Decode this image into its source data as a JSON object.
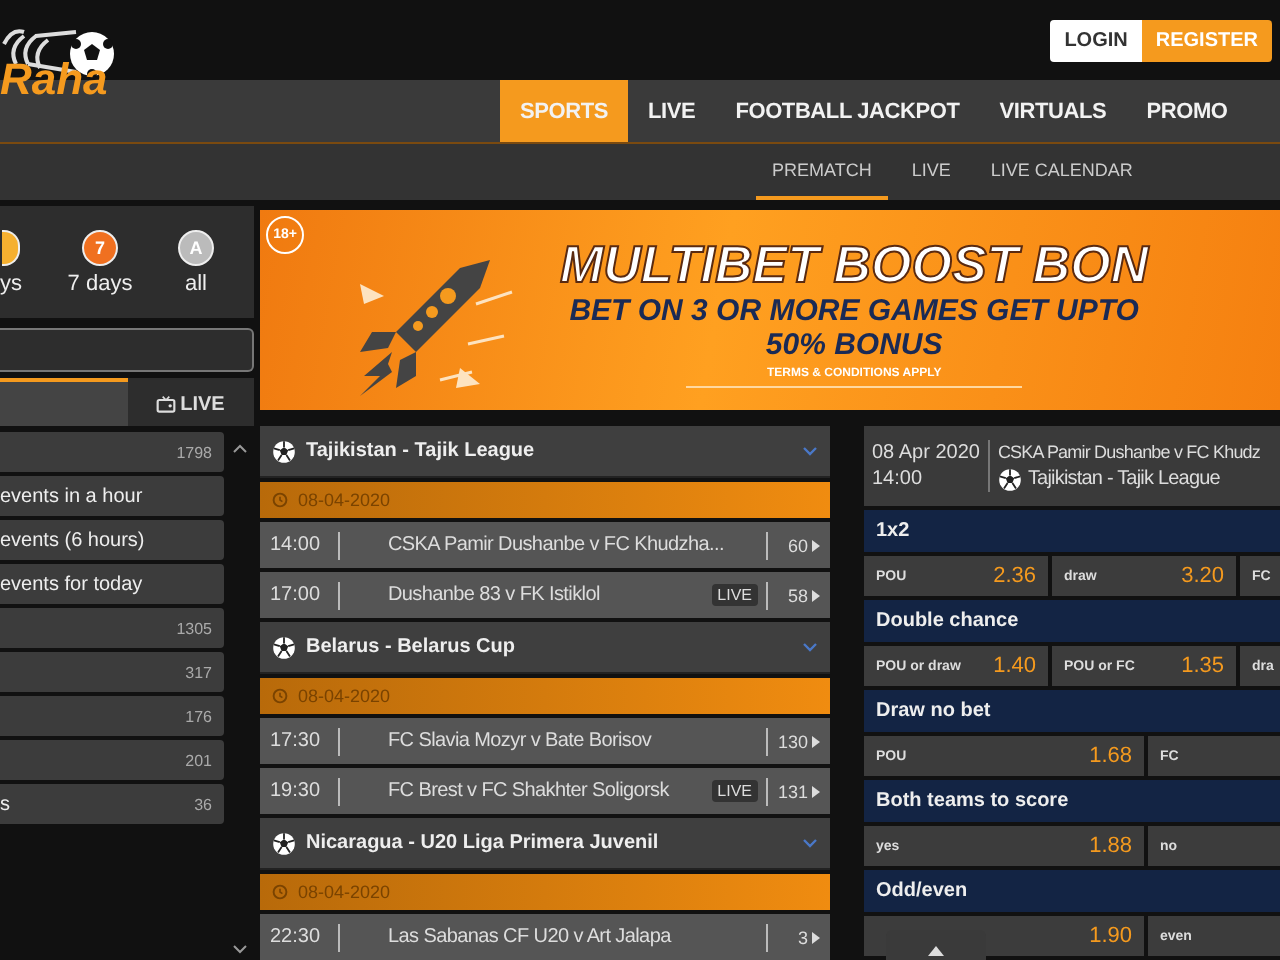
{
  "header": {
    "logo": "Raha",
    "login": "LOGIN",
    "register": "REGISTER"
  },
  "nav": [
    {
      "label": "SPORTS",
      "selected": true
    },
    {
      "label": "LIVE",
      "selected": false
    },
    {
      "label": "FOOTBALL JACKPOT",
      "selected": false
    },
    {
      "label": "VIRTUALS",
      "selected": false
    },
    {
      "label": "PROMO",
      "selected": false
    }
  ],
  "subnav": [
    {
      "label": "PREMATCH",
      "selected": true
    },
    {
      "label": "LIVE",
      "selected": false
    },
    {
      "label": "LIVE CALENDAR",
      "selected": false
    }
  ],
  "sidebar": {
    "periods": [
      {
        "label": "ys",
        "selected": false
      },
      {
        "badge": "7",
        "label": "7 days",
        "selected": true
      },
      {
        "badge": "A",
        "label": "all",
        "selected": false
      }
    ],
    "tabs": [
      {
        "selected": true
      },
      {
        "label": "LIVE",
        "selected": false
      }
    ],
    "filters": [
      {
        "count": "1798"
      },
      {
        "label": "events in a hour"
      },
      {
        "label": "events (6 hours)"
      },
      {
        "label": "events for today"
      },
      {
        "count": "1305"
      },
      {
        "count": "317"
      },
      {
        "count": "176"
      },
      {
        "count": "201"
      },
      {
        "label": "s",
        "count": "36"
      }
    ]
  },
  "banner": {
    "badge": "18+",
    "title": "MULTIBET BOOST BON",
    "subtitle": "BET ON 3 OR MORE GAMES GET UPTO",
    "bonus": "50% BONUS",
    "terms": "TERMS & CONDITIONS APPLY"
  },
  "leagues": [
    {
      "name": "Tajikistan - Tajik League",
      "date": "08-04-2020",
      "matches": [
        {
          "time": "14:00",
          "teams": "CSKA Pamir Dushanbe v FC Khudzha...",
          "live": false,
          "markets": "60"
        },
        {
          "time": "17:00",
          "teams": "Dushanbe 83 v FK Istiklol",
          "live": true,
          "live_label": "LIVE",
          "markets": "58"
        }
      ]
    },
    {
      "name": "Belarus - Belarus Cup",
      "date": "08-04-2020",
      "matches": [
        {
          "time": "17:30",
          "teams": "FC Slavia Mozyr v Bate Borisov",
          "live": false,
          "markets": "130"
        },
        {
          "time": "19:30",
          "teams": "FC Brest v FC Shakhter Soligorsk",
          "live": true,
          "live_label": "LIVE",
          "markets": "131"
        }
      ]
    },
    {
      "name": "Nicaragua - U20 Liga Primera Juvenil",
      "date": "08-04-2020",
      "matches": [
        {
          "time": "22:30",
          "teams": "Las Sabanas CF U20 v Art Jalapa",
          "live": false,
          "markets": "3"
        }
      ]
    }
  ],
  "event": {
    "date": "08 Apr 2020",
    "time": "14:00",
    "teams": "CSKA Pamir Dushanbe v FC Khudz",
    "league": "Tajikistan - Tajik League",
    "markets": [
      {
        "title": "1x2",
        "kind": "triple",
        "odds": [
          {
            "label": "POU",
            "price": "2.36"
          },
          {
            "label": "draw",
            "price": "3.20"
          },
          {
            "label": "FC"
          }
        ]
      },
      {
        "title": "Double chance",
        "kind": "triple",
        "odds": [
          {
            "label": "POU or draw",
            "price": "1.40"
          },
          {
            "label": "POU or FC",
            "price": "1.35"
          },
          {
            "label": "dra"
          }
        ]
      },
      {
        "title": "Draw no bet",
        "kind": "pair",
        "odds": [
          {
            "label": "POU",
            "price": "1.68"
          },
          {
            "label": "FC"
          }
        ]
      },
      {
        "title": "Both teams to score",
        "kind": "pair",
        "odds": [
          {
            "label": "yes",
            "price": "1.88"
          },
          {
            "label": "no"
          }
        ]
      },
      {
        "title": "Odd/even",
        "kind": "pair",
        "odds": [
          {
            "price": "1.90"
          },
          {
            "label": "even"
          }
        ]
      }
    ]
  }
}
